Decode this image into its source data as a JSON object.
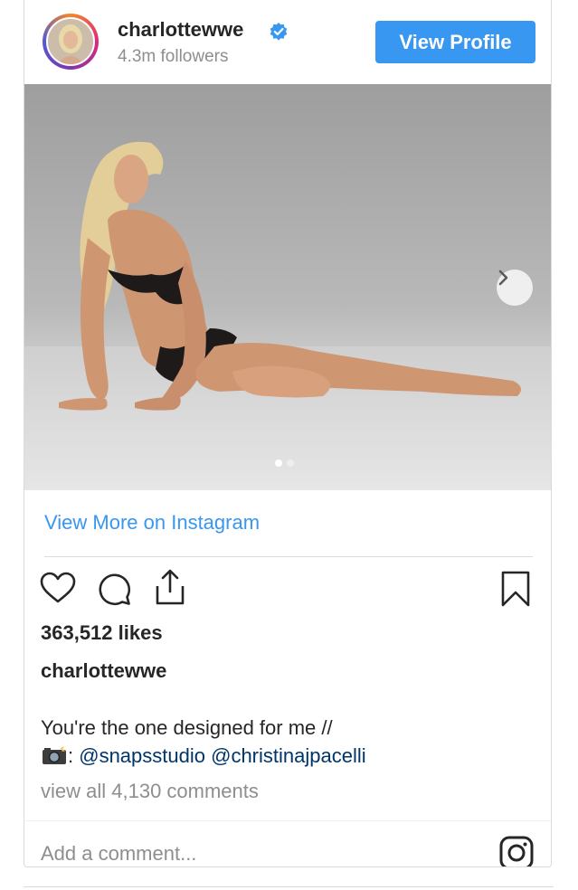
{
  "header": {
    "username": "charlottewwe",
    "followers": "4.3m followers",
    "view_profile_label": "View Profile"
  },
  "media": {
    "carousel_count": 2,
    "active_index": 0
  },
  "links": {
    "view_more_label": "View More on Instagram"
  },
  "actions": {
    "icons": [
      "heart-icon",
      "comment-icon",
      "share-icon",
      "bookmark-icon"
    ]
  },
  "post": {
    "likes": "363,512 likes",
    "caption_user": "charlottewwe",
    "caption_line1": "You're the one designed for me //",
    "caption_line2_prefix": ": ",
    "mention1": "@snapsstudio",
    "mention2": "@christinajpacelli",
    "view_all_comments": "view all 4,130 comments"
  },
  "comment_box": {
    "placeholder": "Add a comment..."
  },
  "colors": {
    "accent": "#3897f0",
    "mention": "#003569",
    "muted": "#8e8e8e",
    "text": "#262626"
  }
}
